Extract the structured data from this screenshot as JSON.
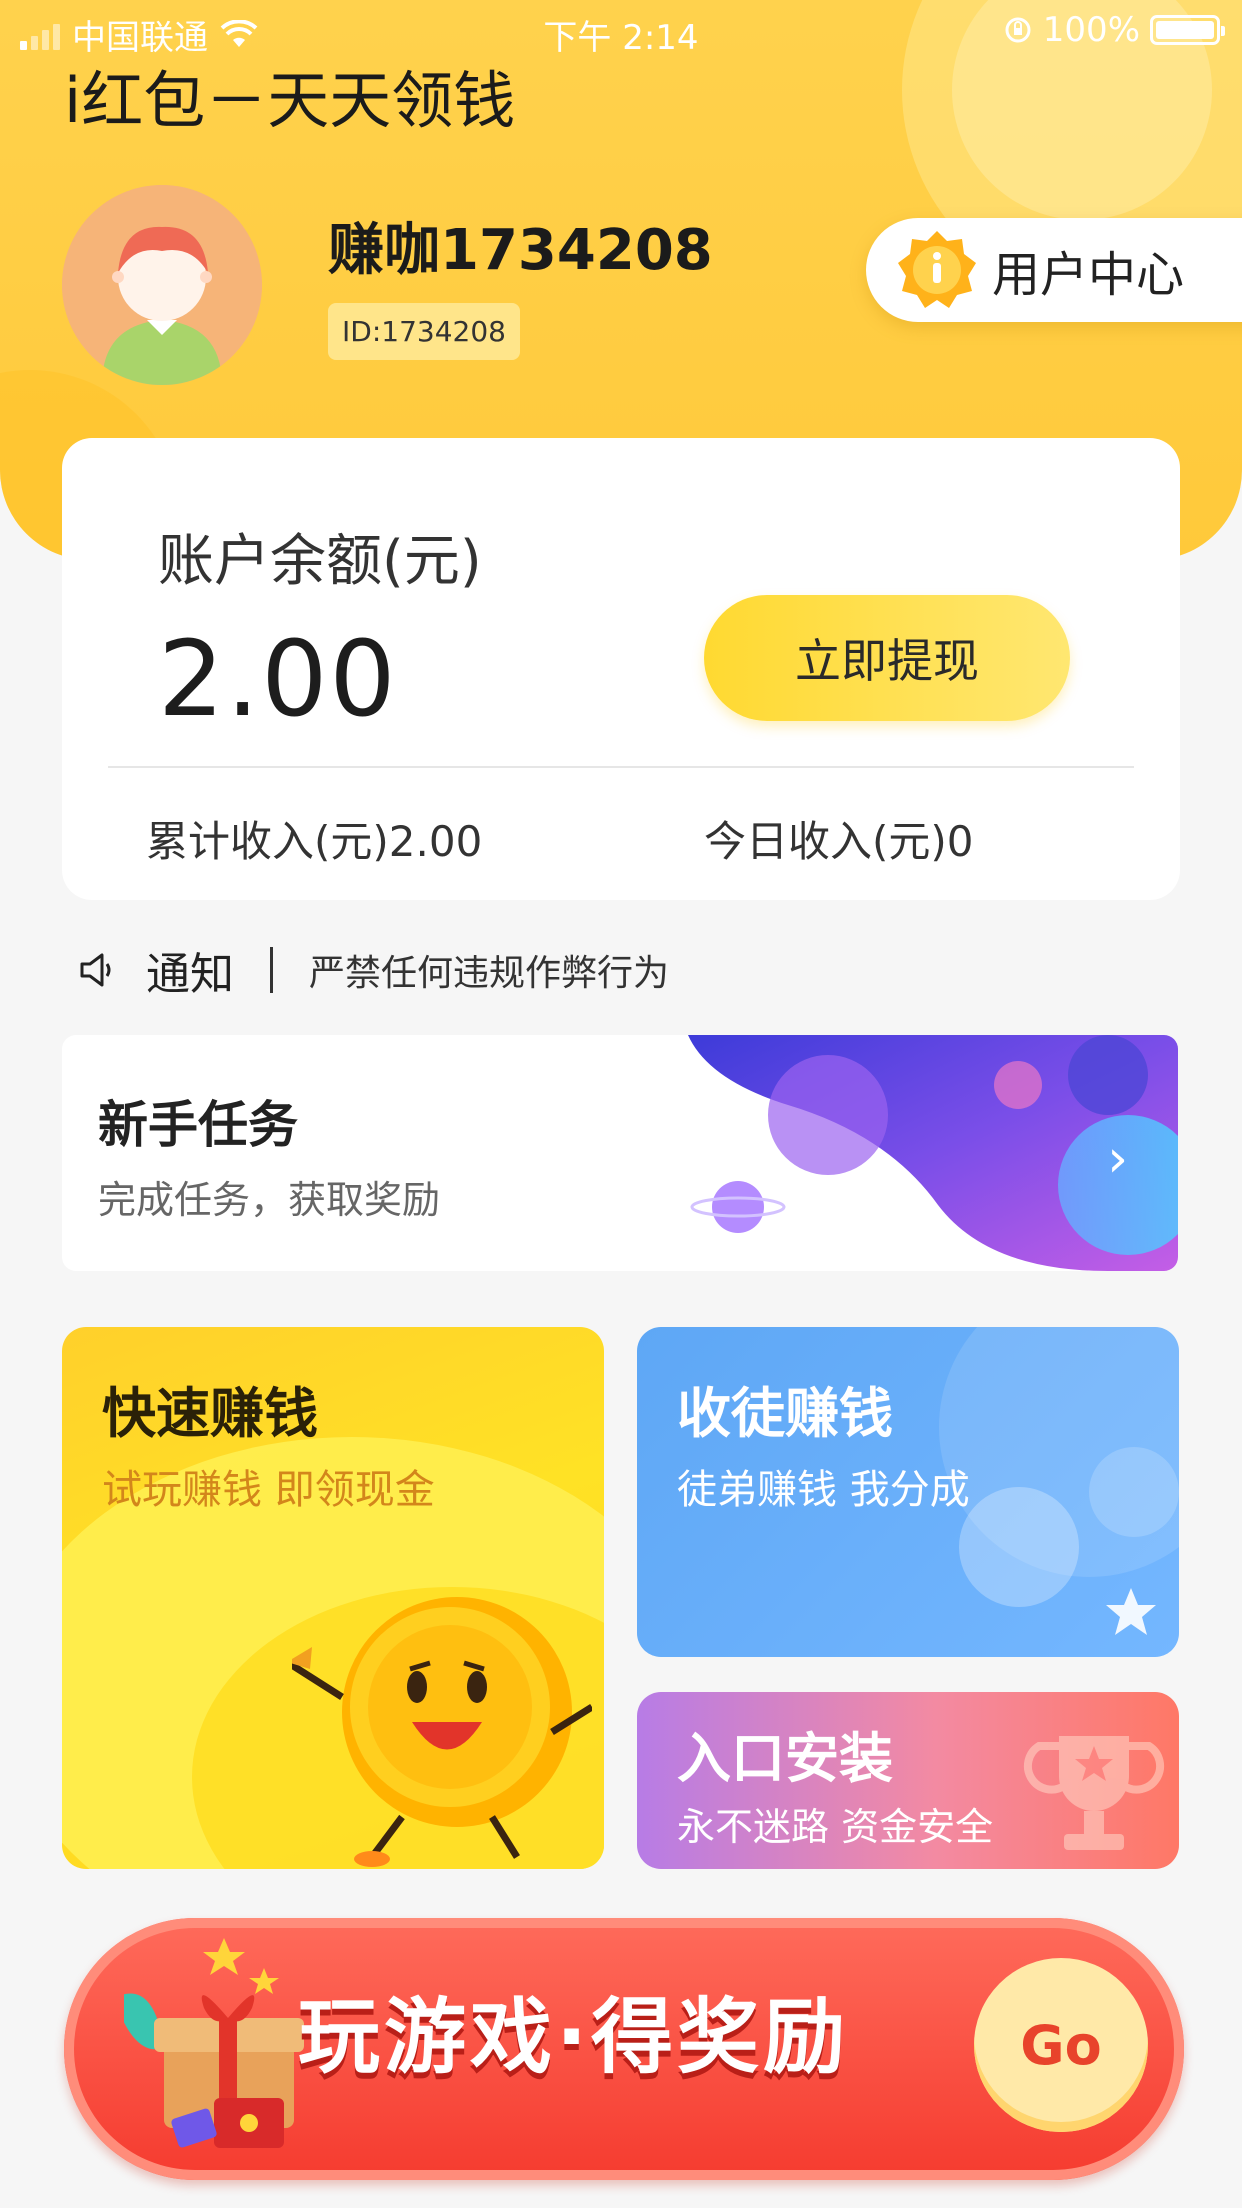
{
  "status_bar": {
    "carrier": "中国联通",
    "time": "下午 2:14",
    "battery": "100%"
  },
  "app_title": "i红包－天天领钱",
  "user": {
    "name": "赚咖1734208",
    "id": "ID:1734208",
    "center_label": "用户中心"
  },
  "balance": {
    "label": "账户余额(元)",
    "value": "2.00",
    "withdraw_label": "立即提现",
    "total_income": "累计收入(元)2.00",
    "today_income": "今日收入(元)0"
  },
  "notice": {
    "title": "通知",
    "text": "严禁任何违规作弊行为"
  },
  "newbie": {
    "title": "新手任务",
    "subtitle": "完成任务，获取奖励"
  },
  "tiles": {
    "fast": {
      "title": "快速赚钱",
      "subtitle": "试玩赚钱 即领现金"
    },
    "apprentice": {
      "title": "收徒赚钱",
      "subtitle": "徒弟赚钱 我分成"
    },
    "install": {
      "title": "入口安装",
      "subtitle": "永不迷路 资金安全"
    }
  },
  "banner": {
    "text": "玩游戏·得奖励",
    "go_label": "Go"
  },
  "colors": {
    "header": "#ffc93a",
    "accent_button": "#ffd931",
    "blue_tile": "#5ea7f5",
    "banner_red": "#f53b2f"
  }
}
